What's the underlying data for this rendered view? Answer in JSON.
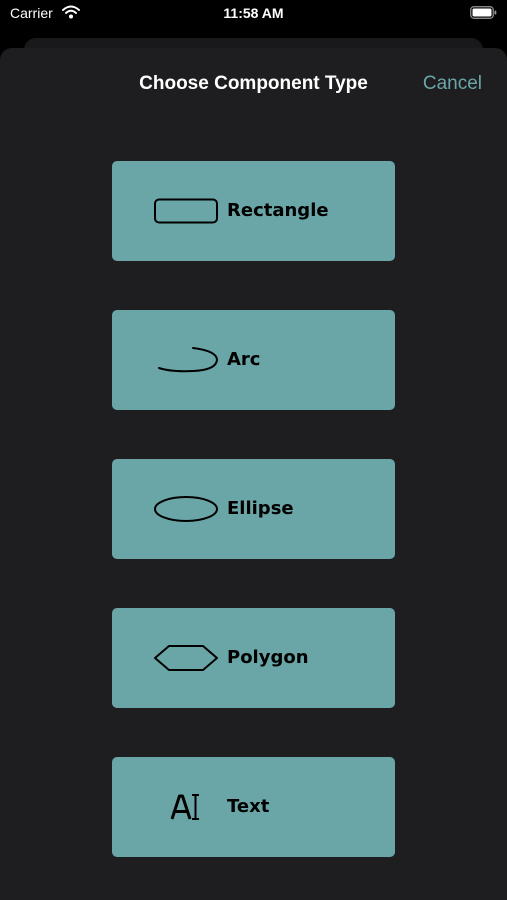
{
  "status_bar": {
    "carrier": "Carrier",
    "time": "11:58 AM"
  },
  "header": {
    "title": "Choose Component Type",
    "cancel_label": "Cancel"
  },
  "colors": {
    "accent": "#6aa6a8",
    "sheet_background": "#1e1e20",
    "button_text": "#000000"
  },
  "options": [
    {
      "label": "Rectangle",
      "icon": "rectangle-icon"
    },
    {
      "label": "Arc",
      "icon": "arc-icon"
    },
    {
      "label": "Ellipse",
      "icon": "ellipse-icon"
    },
    {
      "label": "Polygon",
      "icon": "polygon-icon"
    },
    {
      "label": "Text",
      "icon": "text-icon"
    }
  ]
}
